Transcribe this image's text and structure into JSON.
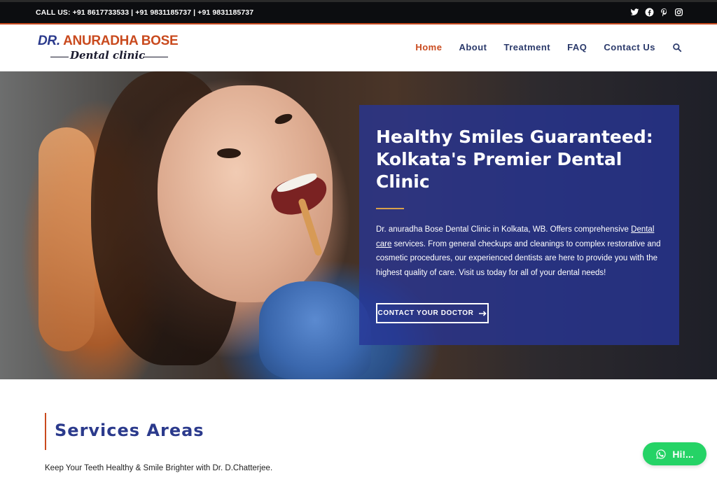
{
  "topbar": {
    "phone": "CALL US: +91 8617733533 | +91 9831185737 | +91 9831185737",
    "social_icons": [
      "twitter-icon",
      "facebook-icon",
      "pinterest-icon",
      "instagram-icon"
    ]
  },
  "logo": {
    "line1_prefix": "DR.",
    "line1_name": "ANURADHA BOSE",
    "line2": "Dental clinic"
  },
  "nav": {
    "items": [
      {
        "label": "Home",
        "active": true
      },
      {
        "label": "About",
        "active": false
      },
      {
        "label": "Treatment",
        "active": false
      },
      {
        "label": "FAQ",
        "active": false
      },
      {
        "label": "Contact Us",
        "active": false
      }
    ],
    "search_icon": "search-icon"
  },
  "hero": {
    "title": "Healthy Smiles Guaranteed: Kolkata's Premier Dental Clinic",
    "desc_before_link": "Dr. anuradha Bose Dental Clinic in Kolkata, WB. Offers comprehensive ",
    "desc_link": "Dental care",
    "desc_after_link": " services. From general checkups and cleanings to complex restorative and cosmetic procedures, our experienced dentists are here to provide you with the highest quality of care. Visit us today for all of your dental needs!",
    "cta_label": "CONTACT YOUR DOCTOR",
    "cta_icon": "arrow-right-icon"
  },
  "services": {
    "heading": "Services Areas",
    "subtext": "Keep Your Teeth Healthy & Smile Brighter with Dr. D.Chatterjee."
  },
  "whatsapp": {
    "label": "Hi!...",
    "icon": "whatsapp-icon"
  },
  "colors": {
    "brand_blue": "#2b3a8c",
    "brand_orange": "#c94a1e",
    "whatsapp_green": "#25d366"
  }
}
